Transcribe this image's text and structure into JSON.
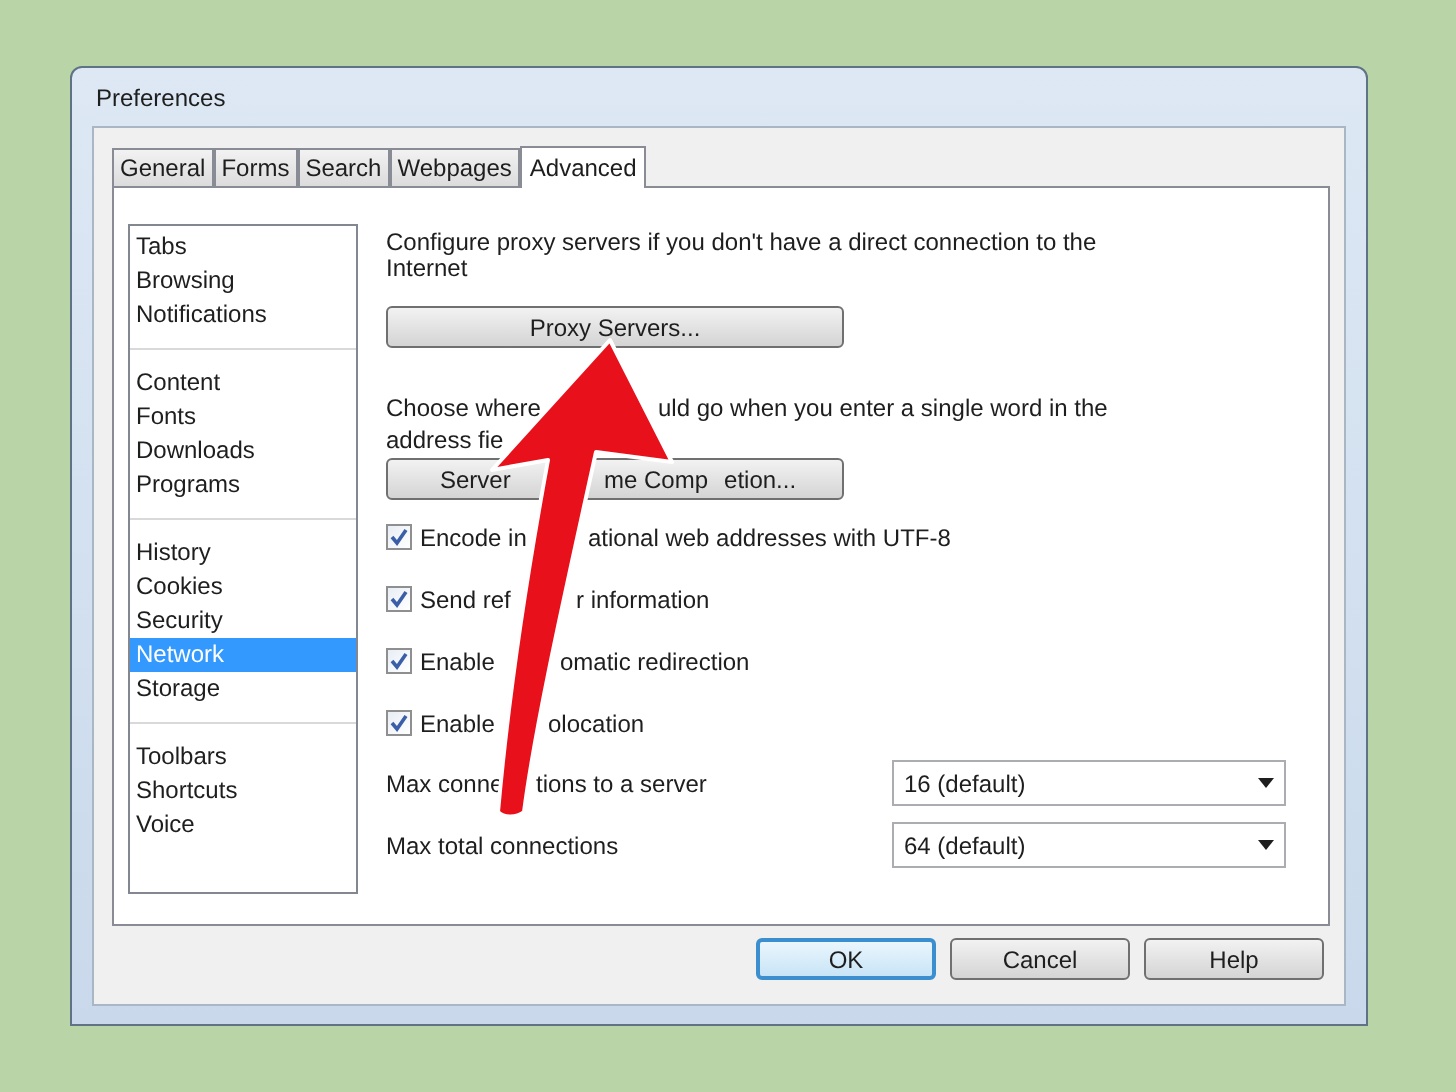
{
  "window": {
    "title": "Preferences"
  },
  "tabs": [
    {
      "label": "General",
      "selected": false
    },
    {
      "label": "Forms",
      "selected": false
    },
    {
      "label": "Search",
      "selected": false
    },
    {
      "label": "Webpages",
      "selected": false
    },
    {
      "label": "Advanced",
      "selected": true
    }
  ],
  "sidebar": {
    "groups": [
      {
        "items": [
          {
            "label": "Tabs",
            "selected": false
          },
          {
            "label": "Browsing",
            "selected": false
          },
          {
            "label": "Notifications",
            "selected": false
          }
        ]
      },
      {
        "items": [
          {
            "label": "Content",
            "selected": false
          },
          {
            "label": "Fonts",
            "selected": false
          },
          {
            "label": "Downloads",
            "selected": false
          },
          {
            "label": "Programs",
            "selected": false
          }
        ]
      },
      {
        "items": [
          {
            "label": "History",
            "selected": false
          },
          {
            "label": "Cookies",
            "selected": false
          },
          {
            "label": "Security",
            "selected": false
          },
          {
            "label": "Network",
            "selected": true
          },
          {
            "label": "Storage",
            "selected": false
          }
        ]
      },
      {
        "items": [
          {
            "label": "Toolbars",
            "selected": false
          },
          {
            "label": "Shortcuts",
            "selected": false
          },
          {
            "label": "Voice",
            "selected": false
          }
        ]
      }
    ]
  },
  "proxy": {
    "description": "Configure proxy servers if you don't have a direct connection to the Internet",
    "button": "Proxy Servers..."
  },
  "completion": {
    "description_lines": [
      [
        "Choose where",
        "uld go when you enter a single word in the"
      ],
      [
        "address fie"
      ]
    ],
    "button_parts": [
      "Server",
      "me Comp",
      "etion..."
    ]
  },
  "checkboxes": [
    {
      "label_parts": [
        "Encode in",
        "ational web addresses with UTF-8"
      ],
      "checked": true
    },
    {
      "label_parts": [
        "Send ref",
        "r information"
      ],
      "checked": true
    },
    {
      "label_parts": [
        "Enable",
        "omatic redirection"
      ],
      "checked": true
    },
    {
      "label_parts": [
        "Enable",
        "olocation"
      ],
      "checked": true
    }
  ],
  "selects": [
    {
      "label_parts": [
        "Max conne",
        "tions to a server"
      ],
      "value": "16 (default)"
    },
    {
      "label_parts": [
        "Max total connections"
      ],
      "value": "64 (default)"
    }
  ],
  "buttons": [
    {
      "label": "OK",
      "default": true
    },
    {
      "label": "Cancel",
      "default": false
    },
    {
      "label": "Help",
      "default": false
    }
  ]
}
